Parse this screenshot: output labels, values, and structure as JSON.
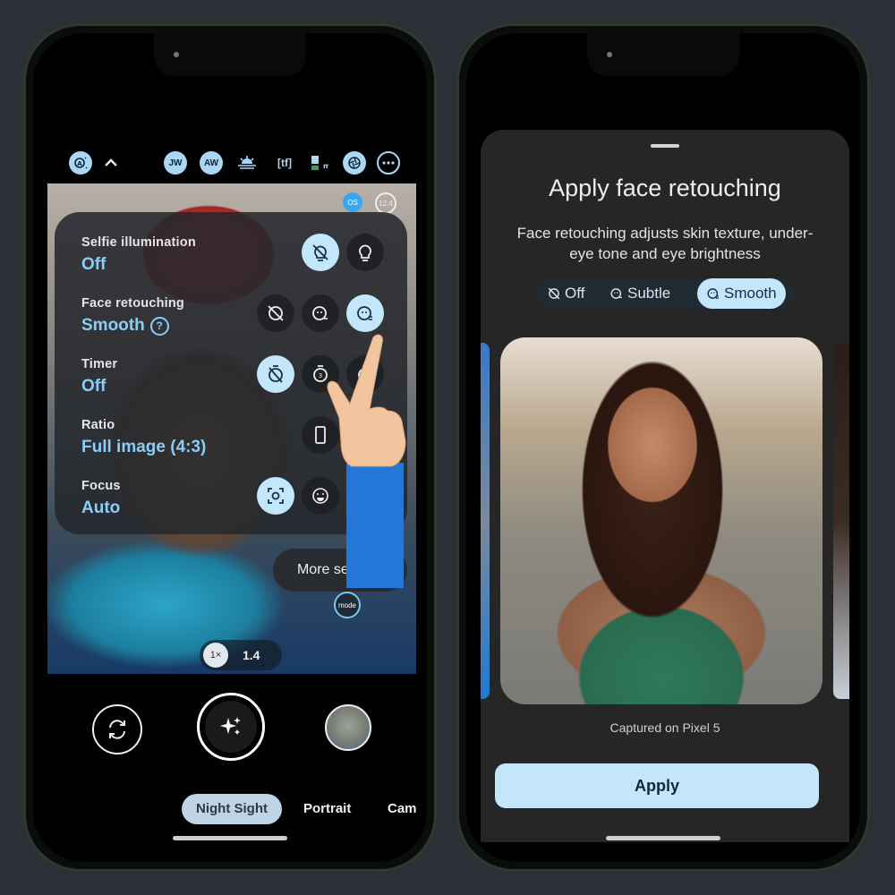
{
  "left_phone": {
    "top_bar": {
      "icons": [
        {
          "name": "auto-exposure-icon",
          "style": "filled"
        },
        {
          "name": "chevron-up-icon",
          "style": "plain"
        },
        {
          "name": "white-balance-jw-icon",
          "label": "JW"
        },
        {
          "name": "white-balance-aw-icon",
          "label": "AW"
        },
        {
          "name": "sunset-exposure-icon"
        },
        {
          "name": "tf-format-icon",
          "label": "[tf]"
        },
        {
          "name": "hdr-mode-icon"
        },
        {
          "name": "aperture-icon"
        },
        {
          "name": "more-options-icon"
        }
      ]
    },
    "viewfinder_badges": {
      "os_label": "OS",
      "counter_label": "12.4"
    },
    "settings": [
      {
        "label": "Selfie illumination",
        "value": "Off",
        "options": [
          "illumination-off",
          "illumination-on"
        ],
        "selected": 0
      },
      {
        "label": "Face retouching",
        "value": "Smooth",
        "has_help": true,
        "options": [
          "retouch-off",
          "retouch-subtle",
          "retouch-smooth"
        ],
        "selected": 2
      },
      {
        "label": "Timer",
        "value": "Off",
        "options": [
          "timer-off",
          "timer-3s",
          "timer-10s"
        ],
        "selected": 0
      },
      {
        "label": "Ratio",
        "value": "Full image (4:3)",
        "options": [
          "ratio-full"
        ],
        "selected": -1
      },
      {
        "label": "Focus",
        "value": "Auto",
        "options": [
          "focus-auto",
          "focus-face"
        ],
        "selected": 0
      }
    ],
    "help_glyph": "?",
    "more_settings_label": "More settings",
    "mode_chip": "mode",
    "zoom": {
      "active": "1×",
      "alt": "1.4"
    },
    "camera_modes": [
      "Night Sight",
      "Portrait",
      "Cam"
    ],
    "active_mode": "Night Sight"
  },
  "right_phone": {
    "sheet": {
      "title": "Apply face retouching",
      "description": "Face retouching adjusts skin texture, under-eye tone and eye brightness",
      "options": [
        {
          "label": "Off",
          "icon": "retouch-off-icon"
        },
        {
          "label": "Subtle",
          "icon": "retouch-subtle-icon"
        },
        {
          "label": "Smooth",
          "icon": "retouch-smooth-icon"
        }
      ],
      "selected": "Smooth",
      "caption": "Captured on Pixel 5",
      "apply_label": "Apply"
    }
  },
  "colors": {
    "accent": "#8ccdf5",
    "selected_bg": "#c2e6fb",
    "apply_bg": "#c4e6fb",
    "background": "#2b2f36"
  }
}
